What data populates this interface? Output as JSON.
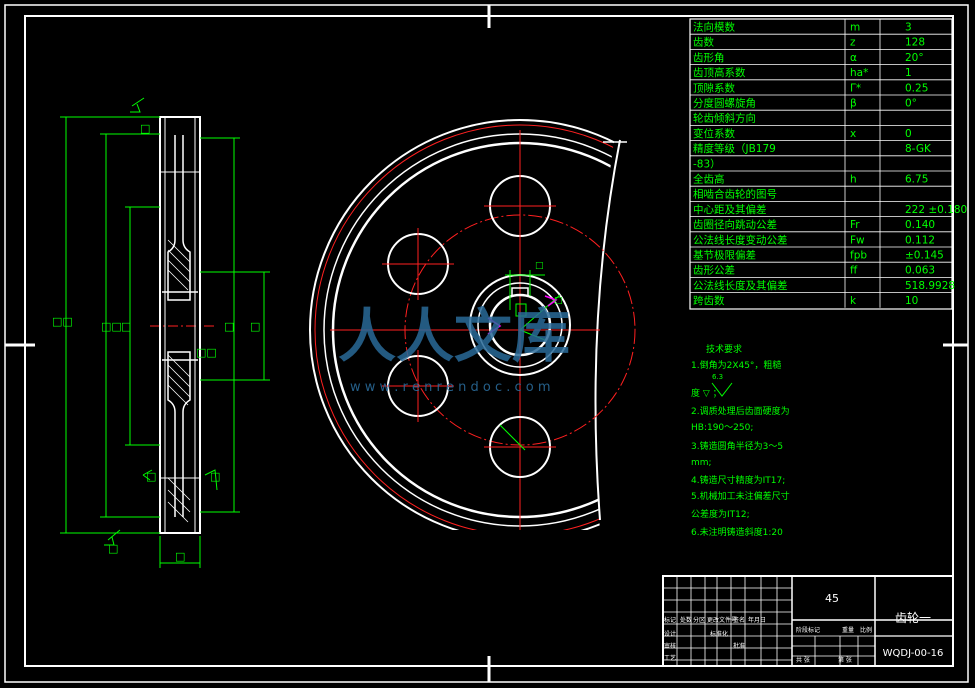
{
  "params": [
    {
      "name": "法向模数",
      "symbol": "m",
      "value": "3"
    },
    {
      "name": "齿数",
      "symbol": "z",
      "value": "128"
    },
    {
      "name": "齿形角",
      "symbol": "α",
      "value": "20°"
    },
    {
      "name": "齿顶高系数",
      "symbol": "ha*",
      "value": "1"
    },
    {
      "name": "顶隙系数",
      "symbol": "Γ*",
      "value": "0.25"
    },
    {
      "name": "分度圆螺旋角",
      "symbol": "β",
      "value": "0°"
    },
    {
      "name": "轮齿倾斜方向",
      "symbol": "",
      "value": ""
    },
    {
      "name": "变位系数",
      "symbol": "x",
      "value": "0"
    },
    {
      "name": "精度等级（JB179",
      "symbol": "",
      "value": "8-GK"
    },
    {
      "name": "-83）",
      "symbol": "",
      "value": ""
    },
    {
      "name": "全齿高",
      "symbol": "h",
      "value": "6.75"
    },
    {
      "name": "相啮合齿轮的图号",
      "symbol": "",
      "value": ""
    },
    {
      "name": "中心距及其偏差",
      "symbol": "",
      "value": "222  ±0.180"
    },
    {
      "name": "齿圈径向跳动公差",
      "symbol": "Fr",
      "value": "0.140"
    },
    {
      "name": "公法线长度变动公差",
      "symbol": "Fw",
      "value": "0.112"
    },
    {
      "name": "基节极限偏差",
      "symbol": "fpb",
      "value": "±0.145"
    },
    {
      "name": "齿形公差",
      "symbol": "ff",
      "value": "0.063"
    },
    {
      "name": "公法线长度及其偏差",
      "symbol": "",
      "value": "518.9928"
    },
    {
      "name": "跨齿数",
      "symbol": "k",
      "value": "10"
    }
  ],
  "tech": {
    "heading": "技术要求",
    "lines": [
      "1.倒角为2X45°，粗糙",
      "度 ▽ ；",
      "2.调质处理后齿面硬度为",
      "  HB:190～250;",
      "3.铸造圆角半径为3～5",
      "mm;",
      "4.铸造尺寸精度为IT17;",
      "5.机械加工未注偏差尺寸",
      "公差度为IT12;",
      "6.未注明铸造斜度1:20"
    ],
    "roughness": "6.3"
  },
  "title_block": {
    "material": "45",
    "part_name": "齿轮一",
    "drawing_no": "WQDJ-00-16",
    "labels": [
      "标记",
      "处数",
      "分区",
      "更改文件号",
      "签名",
      "年月日",
      "设计",
      "标准化",
      "审核",
      "工艺",
      "批准",
      "阶段标记",
      "重量",
      "比例",
      "共 张",
      "第 张"
    ]
  },
  "watermark": {
    "brand": "人人文库",
    "url": "w w w . r e n r e n d o c . c o m"
  },
  "colors": {
    "background": "#000000",
    "geometry": "#ffffff",
    "dimension": "#00ff00",
    "centerline": "#ff2020",
    "accent": "#ff00ff",
    "watermark": "#2a6a98"
  }
}
